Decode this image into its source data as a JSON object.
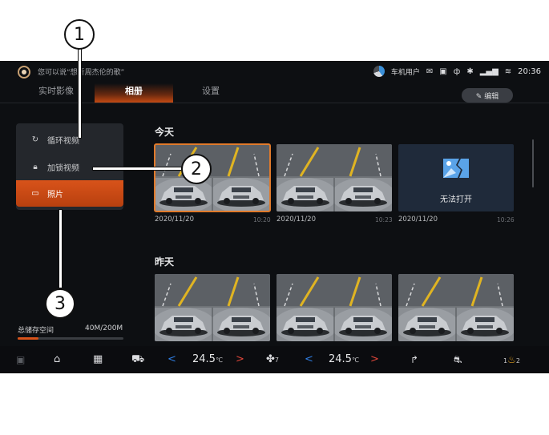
{
  "status": {
    "voice_hint": "您可以说“想听周杰伦的歌”",
    "user": "车机用户",
    "icons": [
      "message-icon",
      "card-icon",
      "phone-icon",
      "bluetooth-icon",
      "signal-icon",
      "wifi-icon"
    ],
    "time": "20:36"
  },
  "tabs": [
    "实时影像",
    "相册",
    "设置"
  ],
  "edit_label": "✎ 编辑",
  "menu": {
    "items": [
      {
        "icon": "loop-icon",
        "label": "循环视频"
      },
      {
        "icon": "lock-icon",
        "label": "加锁视频"
      },
      {
        "icon": "photo-icon",
        "label": "照片"
      }
    ]
  },
  "storage": {
    "label": "总储存空间",
    "value": "40M/200M",
    "fraction": 0.2
  },
  "sections": [
    {
      "title": "今天",
      "items": [
        {
          "date": "2020/11/20",
          "time": "10:20",
          "selected": true
        },
        {
          "date": "2020/11/20",
          "time": "10:23",
          "selected": false
        },
        {
          "date": "2020/11/20",
          "time": "10:26",
          "unopenable": true,
          "label": "无法打开"
        }
      ]
    },
    {
      "title": "昨天",
      "items": [
        {},
        {},
        {}
      ]
    }
  ],
  "bottom": {
    "left_temp": "24.5",
    "right_temp": "24.5",
    "temp_unit": "℃",
    "fan_level": "7",
    "seat_level_left": "1",
    "seat_level_right": "2"
  },
  "callouts": [
    "1",
    "2",
    "3"
  ]
}
